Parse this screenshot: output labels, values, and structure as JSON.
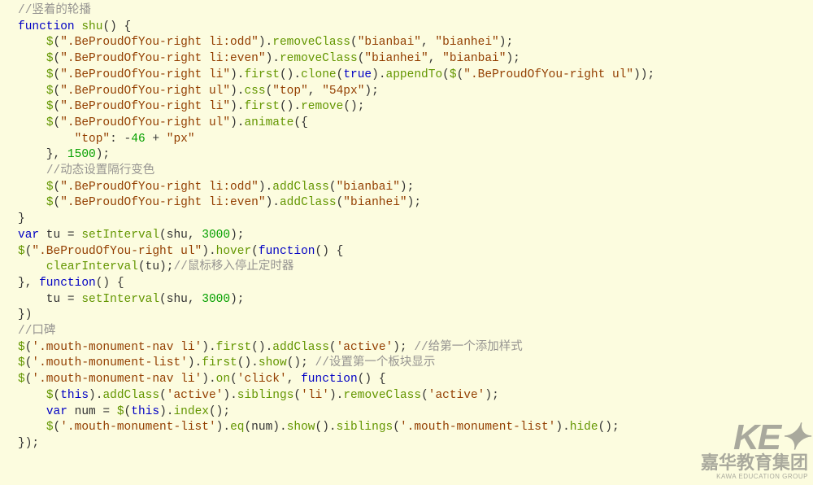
{
  "tokens": [
    [
      [
        "cmt",
        "//竖着的轮播"
      ]
    ],
    [
      [
        "kw",
        "function"
      ],
      [
        "op",
        " "
      ],
      [
        "fn",
        "shu"
      ],
      [
        "op",
        "() {"
      ]
    ],
    [
      [
        "op",
        "    "
      ],
      [
        "fn",
        "$"
      ],
      [
        "op",
        "("
      ],
      [
        "str",
        "\".BeProudOfYou-right li:odd\""
      ],
      [
        "op",
        ")."
      ],
      [
        "fn",
        "removeClass"
      ],
      [
        "op",
        "("
      ],
      [
        "str",
        "\"bianbai\""
      ],
      [
        "op",
        ", "
      ],
      [
        "str",
        "\"bianhei\""
      ],
      [
        "op",
        ");"
      ]
    ],
    [
      [
        "op",
        "    "
      ],
      [
        "fn",
        "$"
      ],
      [
        "op",
        "("
      ],
      [
        "str",
        "\".BeProudOfYou-right li:even\""
      ],
      [
        "op",
        ")."
      ],
      [
        "fn",
        "removeClass"
      ],
      [
        "op",
        "("
      ],
      [
        "str",
        "\"bianhei\""
      ],
      [
        "op",
        ", "
      ],
      [
        "str",
        "\"bianbai\""
      ],
      [
        "op",
        ");"
      ]
    ],
    [
      [
        "op",
        "    "
      ],
      [
        "fn",
        "$"
      ],
      [
        "op",
        "("
      ],
      [
        "str",
        "\".BeProudOfYou-right li\""
      ],
      [
        "op",
        ")."
      ],
      [
        "fn",
        "first"
      ],
      [
        "op",
        "()."
      ],
      [
        "fn",
        "clone"
      ],
      [
        "op",
        "("
      ],
      [
        "kw",
        "true"
      ],
      [
        "op",
        ")."
      ],
      [
        "fn",
        "appendTo"
      ],
      [
        "op",
        "("
      ],
      [
        "fn",
        "$"
      ],
      [
        "op",
        "("
      ],
      [
        "str",
        "\".BeProudOfYou-right ul\""
      ],
      [
        "op",
        "));"
      ]
    ],
    [
      [
        "op",
        "    "
      ],
      [
        "fn",
        "$"
      ],
      [
        "op",
        "("
      ],
      [
        "str",
        "\".BeProudOfYou-right ul\""
      ],
      [
        "op",
        ")."
      ],
      [
        "fn",
        "css"
      ],
      [
        "op",
        "("
      ],
      [
        "str",
        "\"top\""
      ],
      [
        "op",
        ", "
      ],
      [
        "str",
        "\"54px\""
      ],
      [
        "op",
        ");"
      ]
    ],
    [
      [
        "op",
        "    "
      ],
      [
        "fn",
        "$"
      ],
      [
        "op",
        "("
      ],
      [
        "str",
        "\".BeProudOfYou-right li\""
      ],
      [
        "op",
        ")."
      ],
      [
        "fn",
        "first"
      ],
      [
        "op",
        "()."
      ],
      [
        "fn",
        "remove"
      ],
      [
        "op",
        "();"
      ]
    ],
    [
      [
        "op",
        "    "
      ],
      [
        "fn",
        "$"
      ],
      [
        "op",
        "("
      ],
      [
        "str",
        "\".BeProudOfYou-right ul\""
      ],
      [
        "op",
        ")."
      ],
      [
        "fn",
        "animate"
      ],
      [
        "op",
        "({"
      ]
    ],
    [
      [
        "op",
        "        "
      ],
      [
        "str",
        "\"top\""
      ],
      [
        "op",
        ": -"
      ],
      [
        "num",
        "46"
      ],
      [
        "op",
        " + "
      ],
      [
        "str",
        "\"px\""
      ]
    ],
    [
      [
        "op",
        "    }, "
      ],
      [
        "num",
        "1500"
      ],
      [
        "op",
        ");"
      ]
    ],
    [
      [
        "op",
        "    "
      ],
      [
        "cmt",
        "//动态设置隔行变色"
      ]
    ],
    [
      [
        "op",
        "    "
      ],
      [
        "fn",
        "$"
      ],
      [
        "op",
        "("
      ],
      [
        "str",
        "\".BeProudOfYou-right li:odd\""
      ],
      [
        "op",
        ")."
      ],
      [
        "fn",
        "addClass"
      ],
      [
        "op",
        "("
      ],
      [
        "str",
        "\"bianbai\""
      ],
      [
        "op",
        ");"
      ]
    ],
    [
      [
        "op",
        "    "
      ],
      [
        "fn",
        "$"
      ],
      [
        "op",
        "("
      ],
      [
        "str",
        "\".BeProudOfYou-right li:even\""
      ],
      [
        "op",
        ")."
      ],
      [
        "fn",
        "addClass"
      ],
      [
        "op",
        "("
      ],
      [
        "str",
        "\"bianhei\""
      ],
      [
        "op",
        ");"
      ]
    ],
    [
      [
        "op",
        "}"
      ]
    ],
    [
      [
        "kw",
        "var"
      ],
      [
        "op",
        " tu = "
      ],
      [
        "fn",
        "setInterval"
      ],
      [
        "op",
        "(shu, "
      ],
      [
        "num",
        "3000"
      ],
      [
        "op",
        ");"
      ]
    ],
    [
      [
        "fn",
        "$"
      ],
      [
        "op",
        "("
      ],
      [
        "str",
        "\".BeProudOfYou-right ul\""
      ],
      [
        "op",
        ")."
      ],
      [
        "fn",
        "hover"
      ],
      [
        "op",
        "("
      ],
      [
        "kw",
        "function"
      ],
      [
        "op",
        "() {"
      ]
    ],
    [
      [
        "op",
        "    "
      ],
      [
        "fn",
        "clearInterval"
      ],
      [
        "op",
        "(tu);"
      ],
      [
        "cmt",
        "//鼠标移入停止定时器"
      ]
    ],
    [
      [
        "op",
        "}, "
      ],
      [
        "kw",
        "function"
      ],
      [
        "op",
        "() {"
      ]
    ],
    [
      [
        "op",
        "    tu = "
      ],
      [
        "fn",
        "setInterval"
      ],
      [
        "op",
        "(shu, "
      ],
      [
        "num",
        "3000"
      ],
      [
        "op",
        ");"
      ]
    ],
    [
      [
        "op",
        "})"
      ]
    ],
    [
      [
        "cmt",
        "//口碑"
      ]
    ],
    [
      [
        "fn",
        "$"
      ],
      [
        "op",
        "("
      ],
      [
        "str",
        "'.mouth-monument-nav li'"
      ],
      [
        "op",
        ")."
      ],
      [
        "fn",
        "first"
      ],
      [
        "op",
        "()."
      ],
      [
        "fn",
        "addClass"
      ],
      [
        "op",
        "("
      ],
      [
        "str",
        "'active'"
      ],
      [
        "op",
        "); "
      ],
      [
        "cmt",
        "//给第一个添加样式"
      ]
    ],
    [
      [
        "fn",
        "$"
      ],
      [
        "op",
        "("
      ],
      [
        "str",
        "'.mouth-monument-list'"
      ],
      [
        "op",
        ")."
      ],
      [
        "fn",
        "first"
      ],
      [
        "op",
        "()."
      ],
      [
        "fn",
        "show"
      ],
      [
        "op",
        "(); "
      ],
      [
        "cmt",
        "//设置第一个板块显示"
      ]
    ],
    [
      [
        "fn",
        "$"
      ],
      [
        "op",
        "("
      ],
      [
        "str",
        "'.mouth-monument-nav li'"
      ],
      [
        "op",
        ")."
      ],
      [
        "fn",
        "on"
      ],
      [
        "op",
        "("
      ],
      [
        "str",
        "'click'"
      ],
      [
        "op",
        ", "
      ],
      [
        "kw",
        "function"
      ],
      [
        "op",
        "() {"
      ]
    ],
    [
      [
        "op",
        "    "
      ],
      [
        "fn",
        "$"
      ],
      [
        "op",
        "("
      ],
      [
        "kw",
        "this"
      ],
      [
        "op",
        ")."
      ],
      [
        "fn",
        "addClass"
      ],
      [
        "op",
        "("
      ],
      [
        "str",
        "'active'"
      ],
      [
        "op",
        ")."
      ],
      [
        "fn",
        "siblings"
      ],
      [
        "op",
        "("
      ],
      [
        "str",
        "'li'"
      ],
      [
        "op",
        ")."
      ],
      [
        "fn",
        "removeClass"
      ],
      [
        "op",
        "("
      ],
      [
        "str",
        "'active'"
      ],
      [
        "op",
        ");"
      ]
    ],
    [
      [
        "op",
        "    "
      ],
      [
        "kw",
        "var"
      ],
      [
        "op",
        " num = "
      ],
      [
        "fn",
        "$"
      ],
      [
        "op",
        "("
      ],
      [
        "kw",
        "this"
      ],
      [
        "op",
        ")."
      ],
      [
        "fn",
        "index"
      ],
      [
        "op",
        "();"
      ]
    ],
    [
      [
        "op",
        "    "
      ],
      [
        "fn",
        "$"
      ],
      [
        "op",
        "("
      ],
      [
        "str",
        "'.mouth-monument-list'"
      ],
      [
        "op",
        ")."
      ],
      [
        "fn",
        "eq"
      ],
      [
        "op",
        "(num)."
      ],
      [
        "fn",
        "show"
      ],
      [
        "op",
        "()."
      ],
      [
        "fn",
        "siblings"
      ],
      [
        "op",
        "("
      ],
      [
        "str",
        "'.mouth-monument-list'"
      ],
      [
        "op",
        ")."
      ],
      [
        "fn",
        "hide"
      ],
      [
        "op",
        "();"
      ]
    ],
    [
      [
        "op",
        "});"
      ]
    ]
  ],
  "watermark": {
    "keg": "KE✦",
    "cn": "嘉华教育集团",
    "en": "KAWA EDUCATION GROUP"
  }
}
